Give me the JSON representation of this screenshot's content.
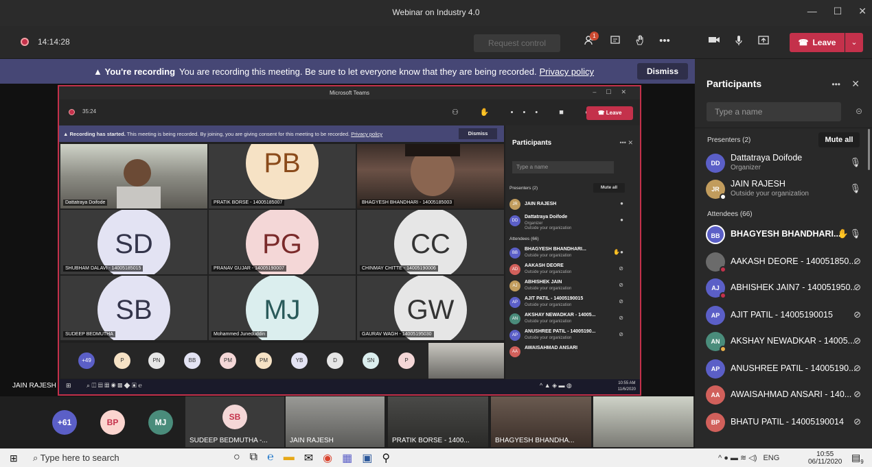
{
  "window": {
    "title": "Webinar on Industry 4.0",
    "controls": [
      "—",
      "☐",
      "✕"
    ]
  },
  "controlbar": {
    "timer": "14:14:28",
    "request_control": "Request control",
    "participants_badge": "1",
    "leave": "Leave",
    "icons": [
      "participants-icon",
      "chat-icon",
      "raise-hand-icon",
      "more-icon",
      "camera-icon",
      "mic-icon",
      "share-icon"
    ]
  },
  "banner": {
    "bold": "You're recording",
    "text": "You are recording this meeting. Be sure to let everyone know that they are being recorded.",
    "link": "Privacy policy",
    "dismiss": "Dismiss"
  },
  "inner": {
    "title": "Microsoft Teams",
    "timer": "35:24",
    "leave": "Leave",
    "banner_bold": "Recording has started.",
    "banner_text": "This meeting is being recorded. By joining, you are giving consent for this meeting to be recorded.",
    "banner_link": "Privacy policy",
    "banner_dismiss": "Dismiss",
    "tiles": [
      {
        "label": "Dattatraya Doifode",
        "initials": "",
        "color": ""
      },
      {
        "label": "PRATIK BORSE - 14005185007",
        "initials": "PB",
        "color": "#f6e2c5"
      },
      {
        "label": "BHAGYESH BHANDHARI - 14005185003",
        "initials": "",
        "color": ""
      },
      {
        "label": "SHUBHAM DALAVI - 14005185015",
        "initials": "SD",
        "color": "#e3e3f3"
      },
      {
        "label": "PRANAV GUJAR - 14005190007",
        "initials": "PG",
        "color": "#f4d7d7"
      },
      {
        "label": "CHINMAY CHITTE - 14005190006",
        "initials": "CC",
        "color": "#e6e6e6"
      },
      {
        "label": "SUDEEP BEDMUTHA",
        "initials": "SB",
        "color": "#e3e3f3"
      },
      {
        "label": "Mohammed Juneduddin",
        "initials": "MJ",
        "color": "#dbeeee"
      },
      {
        "label": "GAURAV WAGH - 14005195030",
        "initials": "GW",
        "color": "#e6e6e6"
      }
    ],
    "strip": [
      "+49",
      "P",
      "PN",
      "BB",
      "PM",
      "PM",
      "YB",
      "D",
      "SN",
      "P"
    ],
    "panel": {
      "title": "Participants",
      "search": "Type a name",
      "presenters": "Presenters (2)",
      "mute_all": "Mute all",
      "attendees": "Attendees (66)",
      "people": [
        {
          "initials": "JR",
          "name": "JAIN RAJESH",
          "sub": ""
        },
        {
          "initials": "DD",
          "name": "Dattatraya Doifode",
          "sub": "Organizer"
        },
        {
          "initials": "BB",
          "name": "BHAGYESH BHANDHARI...",
          "sub": "Outside your organization"
        },
        {
          "initials": "AD",
          "name": "AAKASH DEORE",
          "sub": "Outside your organization"
        },
        {
          "initials": "AJ",
          "name": "ABHISHEK JAIN",
          "sub": "Outside your organization"
        },
        {
          "initials": "AP",
          "name": "AJIT PATIL - 14005190015",
          "sub": "Outside your organization"
        },
        {
          "initials": "AN",
          "name": "AKSHAY NEWADKAR - 14005...",
          "sub": "Outside your organization"
        },
        {
          "initials": "AP",
          "name": "ANUSHREE PATIL - 14005190...",
          "sub": "Outside your organization"
        },
        {
          "initials": "AA",
          "name": "AWAISAHMAD ANSARI",
          "sub": ""
        }
      ],
      "dd_sub2": "Outside your organization"
    },
    "clock_time": "10:55 AM",
    "clock_date": "11/6/2020"
  },
  "stage_name": "JAIN RAJESH",
  "panel": {
    "title": "Participants",
    "search": "Type a name",
    "presenters": "Presenters (2)",
    "mute_all": "Mute all",
    "attendees": "Attendees (66)",
    "presenter_list": [
      {
        "initials": "DD",
        "name": "Dattatraya Doifode",
        "sub": "Organizer",
        "color": "#5b5fc7"
      },
      {
        "initials": "JR",
        "name": "JAIN RAJESH",
        "sub": "Outside your organization",
        "color": "#c19c5d"
      }
    ],
    "attendee_list": [
      {
        "initials": "BB",
        "name": "BHAGYESH BHANDHARI...",
        "color": "#5b5fc7"
      },
      {
        "initials": "",
        "name": "AAKASH DEORE - 140051850...",
        "color": "#6b6b6b"
      },
      {
        "initials": "AJ",
        "name": "ABHISHEK JAIN7 - 140051950...",
        "color": "#5b5fc7"
      },
      {
        "initials": "AP",
        "name": "AJIT PATIL - 14005190015",
        "color": "#5b5fc7"
      },
      {
        "initials": "AN",
        "name": "AKSHAY NEWADKAR - 14005...",
        "color": "#4a8c7b"
      },
      {
        "initials": "AP",
        "name": "ANUSHREE PATIL - 14005190...",
        "color": "#5b5fc7"
      },
      {
        "initials": "AA",
        "name": "AWAISAHMAD ANSARI - 140...",
        "color": "#d1605b"
      },
      {
        "initials": "BP",
        "name": "BHATU PATIL - 14005190014",
        "color": "#d1605b"
      }
    ]
  },
  "gallery": {
    "circles": [
      {
        "text": "+61",
        "color": "#5b5fc7",
        "fg": "#fff"
      },
      {
        "text": "BP",
        "color": "#fbd5cf",
        "fg": "#c4314b"
      },
      {
        "text": "MJ",
        "color": "#4a8c7b",
        "fg": "#fff"
      }
    ],
    "sb_initials": "SB",
    "sb_label": "SUDEEP BEDMUTHA -...",
    "tiles": [
      {
        "label": "JAIN RAJESH"
      },
      {
        "label": "PRATIK BORSE - 1400..."
      },
      {
        "label": "BHAGYESH BHANDHA..."
      },
      {
        "label": ""
      }
    ]
  },
  "taskbar": {
    "search": "Type here to search",
    "lang": "ENG",
    "time": "10:55",
    "date": "06/11/2020",
    "notif_count": "9"
  }
}
